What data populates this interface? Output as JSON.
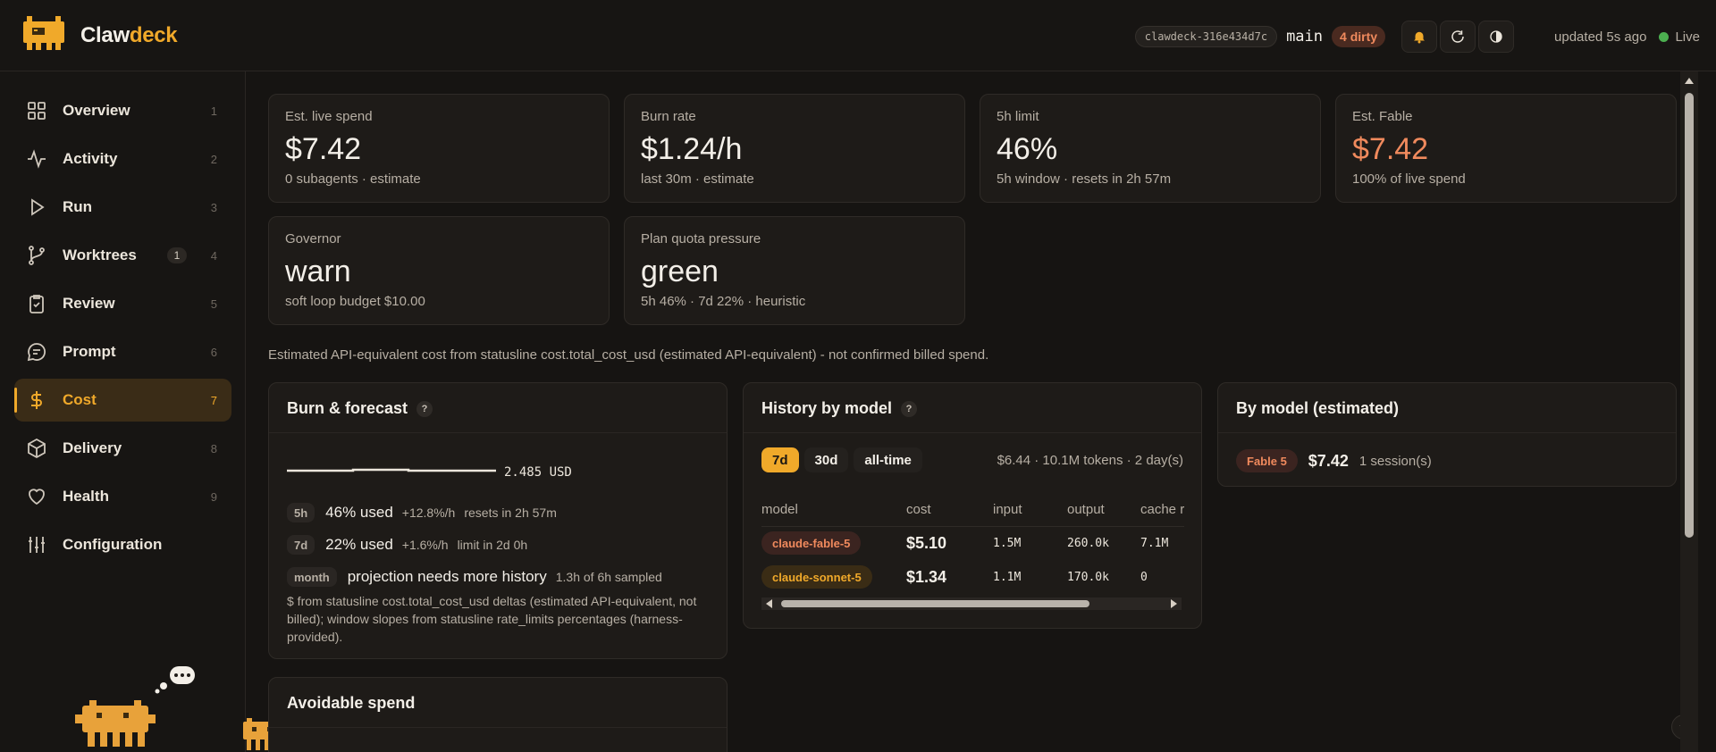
{
  "header": {
    "brand_part1": "Claw",
    "brand_part2": "deck",
    "repo": "clawdeck-316e434d7c",
    "branch": "main",
    "dirty": "4 dirty",
    "updated": "updated 5s ago",
    "live": "Live",
    "icons": [
      "bell-icon",
      "refresh-icon",
      "theme-toggle-icon"
    ]
  },
  "sidebar": {
    "items": [
      {
        "label": "Overview",
        "num": "1",
        "icon": "grid-icon"
      },
      {
        "label": "Activity",
        "num": "2",
        "icon": "pulse-icon"
      },
      {
        "label": "Run",
        "num": "3",
        "icon": "play-icon"
      },
      {
        "label": "Worktrees",
        "num": "4",
        "badge": "1",
        "icon": "branch-icon"
      },
      {
        "label": "Review",
        "num": "5",
        "icon": "clipboard-check-icon"
      },
      {
        "label": "Prompt",
        "num": "6",
        "icon": "chat-icon"
      },
      {
        "label": "Cost",
        "num": "7",
        "icon": "dollar-icon",
        "active": true
      },
      {
        "label": "Delivery",
        "num": "8",
        "icon": "box-icon"
      },
      {
        "label": "Health",
        "num": "9",
        "icon": "heart-icon"
      },
      {
        "label": "Configuration",
        "num": "",
        "icon": "sliders-icon"
      }
    ]
  },
  "stats": [
    {
      "k": "Est. live spend",
      "v": "$7.42",
      "s": "0 subagents · estimate"
    },
    {
      "k": "Burn rate",
      "v": "$1.24/h",
      "s": "last 30m · estimate"
    },
    {
      "k": "5h limit",
      "v": "46%",
      "s": "5h window · resets in 2h 57m"
    },
    {
      "k": "Est. Fable",
      "v": "$7.42",
      "s": "100% of live spend"
    },
    {
      "k": "Governor",
      "v": "warn",
      "s": "soft loop budget $10.00"
    },
    {
      "k": "Plan quota pressure",
      "v": "green",
      "s": "5h 46% · 7d 22% · heuristic"
    }
  ],
  "note": "Estimated API-equivalent cost from statusline cost.total_cost_usd (estimated API-equivalent) - not confirmed billed spend.",
  "burn": {
    "title": "Burn & forecast",
    "help": "?",
    "sparkline_value": "2.485 USD",
    "rows": [
      {
        "chip": "5h",
        "big": "46% used",
        "rate": "+12.8%/h",
        "extra": "resets in 2h 57m"
      },
      {
        "chip": "7d",
        "big": "22% used",
        "rate": "+1.6%/h",
        "extra": "limit in 2d 0h"
      },
      {
        "chip": "month",
        "big": "projection needs more history",
        "rate": "",
        "extra": "1.3h of 6h sampled"
      }
    ],
    "footnote": "$ from statusline cost.total_cost_usd deltas (estimated API-equivalent, not billed); window slopes from statusline rate_limits percentages (harness-provided)."
  },
  "history": {
    "title": "History by model",
    "help": "?",
    "ranges": [
      "7d",
      "30d",
      "all-time"
    ],
    "active_range": "7d",
    "summary": "$6.44 · 10.1M tokens · 2 day(s)",
    "columns": [
      "model",
      "cost",
      "input",
      "output",
      "cache r"
    ],
    "rows": [
      {
        "model": "claude-fable-5",
        "cost": "$5.10",
        "input": "1.5M",
        "output": "260.0k",
        "cache": "7.1M"
      },
      {
        "model": "claude-sonnet-5",
        "cost": "$1.34",
        "input": "1.1M",
        "output": "170.0k",
        "cache": "0"
      }
    ]
  },
  "bymodel": {
    "title": "By model (estimated)",
    "pill": "Fable 5",
    "cost": "$7.42",
    "sessions": "1 session(s)"
  },
  "avoidable": {
    "title": "Avoidable spend"
  },
  "colors": {
    "accent": "#f0a92a",
    "warn": "#f08a5d",
    "live": "#4caf50"
  }
}
